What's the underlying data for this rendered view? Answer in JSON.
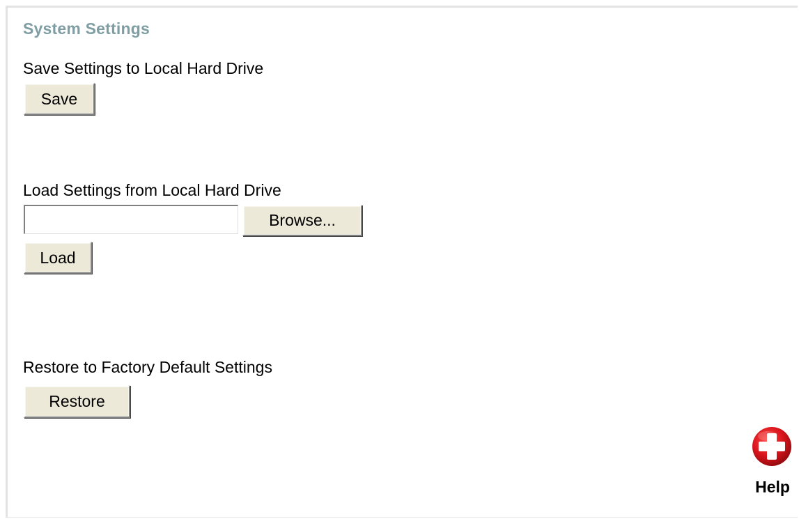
{
  "page": {
    "title": "System Settings"
  },
  "save_section": {
    "label": "Save Settings to Local Hard Drive",
    "button_label": "Save"
  },
  "load_section": {
    "label": "Load Settings from Local Hard Drive",
    "file_value": "",
    "browse_label": "Browse...",
    "button_label": "Load"
  },
  "restore_section": {
    "label": "Restore to Factory Default Settings",
    "button_label": "Restore"
  },
  "help": {
    "label": "Help",
    "icon": "plus-cross-icon",
    "icon_color": "#d9151c"
  },
  "colors": {
    "title": "#7f9ea3",
    "button_face": "#ece9d8"
  }
}
